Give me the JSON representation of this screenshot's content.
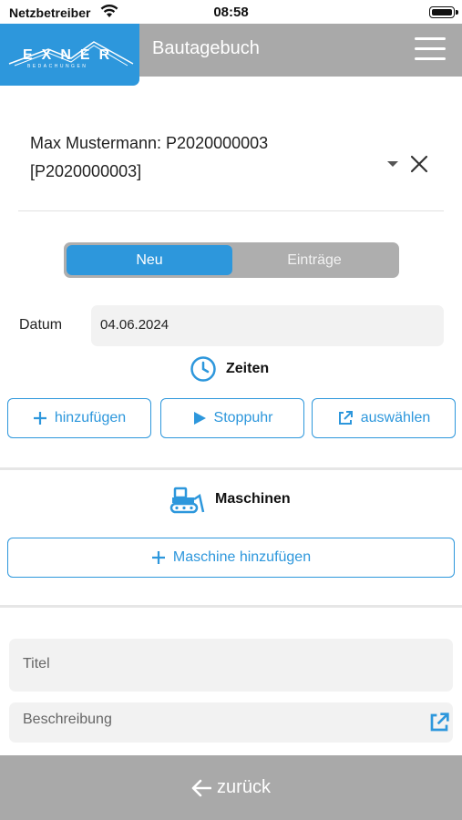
{
  "status_bar": {
    "carrier": "Netzbetreiber",
    "time": "08:58"
  },
  "header": {
    "logo_text": "EXNER",
    "logo_subtext": "BEDACHUNGEN",
    "title": "Bautagebuch",
    "menu_icon": "hamburger-icon"
  },
  "project": {
    "line1": "Max Mustermann: P2020000003",
    "line2": "[P2020000003]"
  },
  "tabs": [
    {
      "label": "Neu",
      "active": true
    },
    {
      "label": "Einträge",
      "active": false
    }
  ],
  "date": {
    "label": "Datum",
    "value": "04.06.2024"
  },
  "zeiten": {
    "title": "Zeiten",
    "icon": "clock-icon",
    "buttons": [
      {
        "label": "hinzufügen",
        "icon": "plus-icon"
      },
      {
        "label": "Stoppuhr",
        "icon": "play-icon"
      },
      {
        "label": "auswählen",
        "icon": "external-link-icon"
      }
    ]
  },
  "maschinen": {
    "title": "Maschinen",
    "icon": "bulldozer-icon",
    "add_label": "Maschine hinzufügen"
  },
  "form": {
    "title_placeholder": "Titel",
    "description_placeholder": "Beschreibung"
  },
  "footer": {
    "back_label": "zurück"
  },
  "colors": {
    "accent": "#2d97dc",
    "header_gray": "#a9a9a9",
    "field_bg": "#f2f2f2"
  }
}
